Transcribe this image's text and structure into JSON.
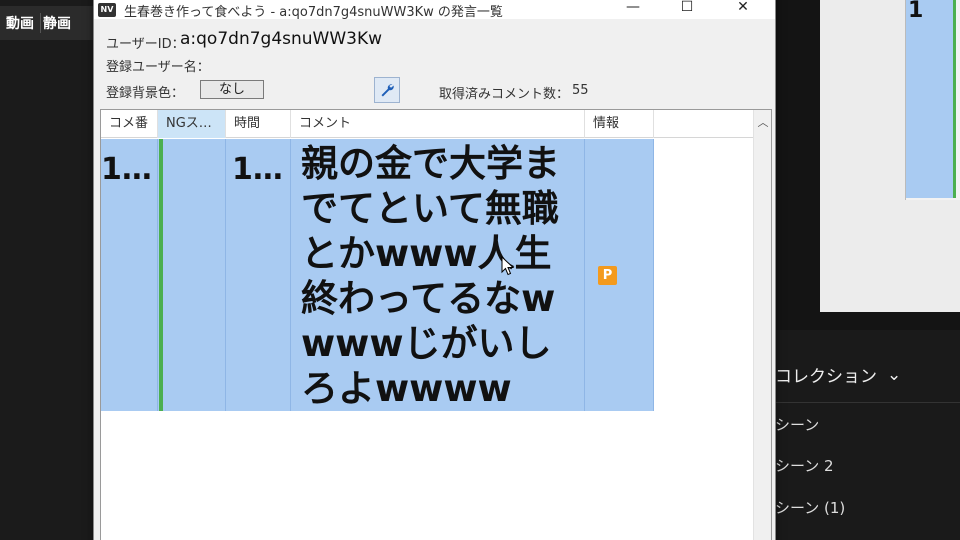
{
  "background_left": {
    "tabs": [
      "動画",
      "静画"
    ]
  },
  "background_right": {
    "collection_label": "コレクション",
    "menu_items": [
      "シーン",
      "シーン 2",
      "シーン (1)"
    ],
    "cell_fragment": "1"
  },
  "window": {
    "title": "生春巻き作って食べよう - a:qo7dn7g4snuWW3Kw の発言一覧",
    "icon_label": "NV",
    "controls": {
      "minimize": "—",
      "maximize": "☐",
      "close": "✕"
    }
  },
  "user_info": {
    "userid_label": "ユーザーID：",
    "userid_value": "a:qo7dn7g4snuWW3Kw",
    "username_label": "登録ユーザー名：",
    "bgcolor_label": "登録背景色：",
    "bgcolor_value": "なし",
    "fetched_label": "取得済みコメント数：",
    "fetched_count": "55"
  },
  "table": {
    "columns": [
      "コメ番",
      "NGス…",
      "時間",
      "コメント",
      "情報"
    ],
    "rows": [
      {
        "comment_no": "1…",
        "ng": "",
        "time": "1…",
        "comment": "親の金で大学までてといて無職とかwww人生終わってるなwwwwじがいしろよwwww",
        "info_badge": "P"
      }
    ]
  },
  "colors": {
    "selection": "#a9cbf2",
    "ng_bar": "#4caf50",
    "badge": "#f39a1e"
  }
}
